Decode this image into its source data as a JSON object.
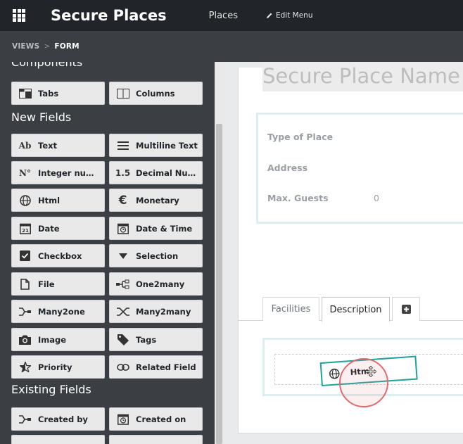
{
  "topbar": {
    "brand": "Secure Places",
    "places": "Places",
    "edit_menu": "Edit Menu"
  },
  "breadcrumb": {
    "views": "VIEWS",
    "separator": ">",
    "form": "FORM"
  },
  "sidebar": {
    "components_title": "Components",
    "new_fields_title": "New Fields",
    "existing_fields_title": "Existing Fields",
    "components": [
      {
        "label": "Tabs",
        "icon": "tabs-icon"
      },
      {
        "label": "Columns",
        "icon": "columns-icon"
      }
    ],
    "new_fields": [
      {
        "label": "Text",
        "icon": "text-ab-icon",
        "glyph": "Ab"
      },
      {
        "label": "Multiline Text",
        "icon": "multiline-icon"
      },
      {
        "label": "Integer number",
        "icon": "integer-icon",
        "glyph": "N°"
      },
      {
        "label": "Decimal Number",
        "icon": "decimal-icon",
        "glyph": "1.5"
      },
      {
        "label": "Html",
        "icon": "globe-icon"
      },
      {
        "label": "Monetary",
        "icon": "euro-icon",
        "glyph": "€"
      },
      {
        "label": "Date",
        "icon": "calendar-icon"
      },
      {
        "label": "Date & Time",
        "icon": "clock-calendar-icon"
      },
      {
        "label": "Checkbox",
        "icon": "checkbox-icon"
      },
      {
        "label": "Selection",
        "icon": "caret-down-icon"
      },
      {
        "label": "File",
        "icon": "file-icon"
      },
      {
        "label": "One2many",
        "icon": "one2many-icon"
      },
      {
        "label": "Many2one",
        "icon": "many2one-icon"
      },
      {
        "label": "Many2many",
        "icon": "many2many-icon"
      },
      {
        "label": "Image",
        "icon": "camera-icon"
      },
      {
        "label": "Tags",
        "icon": "tag-icon"
      },
      {
        "label": "Priority",
        "icon": "star-icon"
      },
      {
        "label": "Related Field",
        "icon": "link-icon"
      }
    ],
    "existing_fields": [
      {
        "label": "Created by",
        "icon": "many2one-icon"
      },
      {
        "label": "Created on",
        "icon": "clock-calendar-icon"
      }
    ]
  },
  "form": {
    "title_placeholder": "Secure Place Name",
    "fields": [
      {
        "label": "Type of Place",
        "value": ""
      },
      {
        "label": "Address",
        "value": ""
      },
      {
        "label": "Max. Guests",
        "value": "0"
      }
    ],
    "tabs": [
      {
        "label": "Facilities",
        "active": false
      },
      {
        "label": "Description",
        "active": true
      }
    ],
    "add_tab_icon": "plus-square-icon"
  },
  "drag": {
    "label": "Html",
    "icon": "globe-icon"
  },
  "colors": {
    "topbar": "#212529",
    "sidebar": "#3b3f44",
    "accent": "#21a19b",
    "cursor_ring": "#e06a6f"
  }
}
